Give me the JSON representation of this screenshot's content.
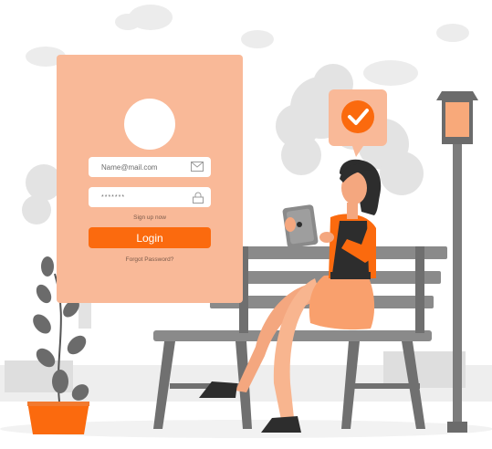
{
  "login_card": {
    "email_placeholder": "Name@mail.com",
    "password_value": "*******",
    "signup_link": "Sign up now",
    "login_button": "Login",
    "forgot_link": "Forgot Password?"
  },
  "icons": {
    "email": "envelope-icon",
    "password": "lock-icon",
    "confirmation": "checkmark-icon"
  },
  "colors": {
    "accent": "#fb6a0e",
    "card": "#f9b998",
    "bench": "#8a8a8a",
    "skin": "#f4a77f",
    "dark": "#2d2d2d"
  }
}
